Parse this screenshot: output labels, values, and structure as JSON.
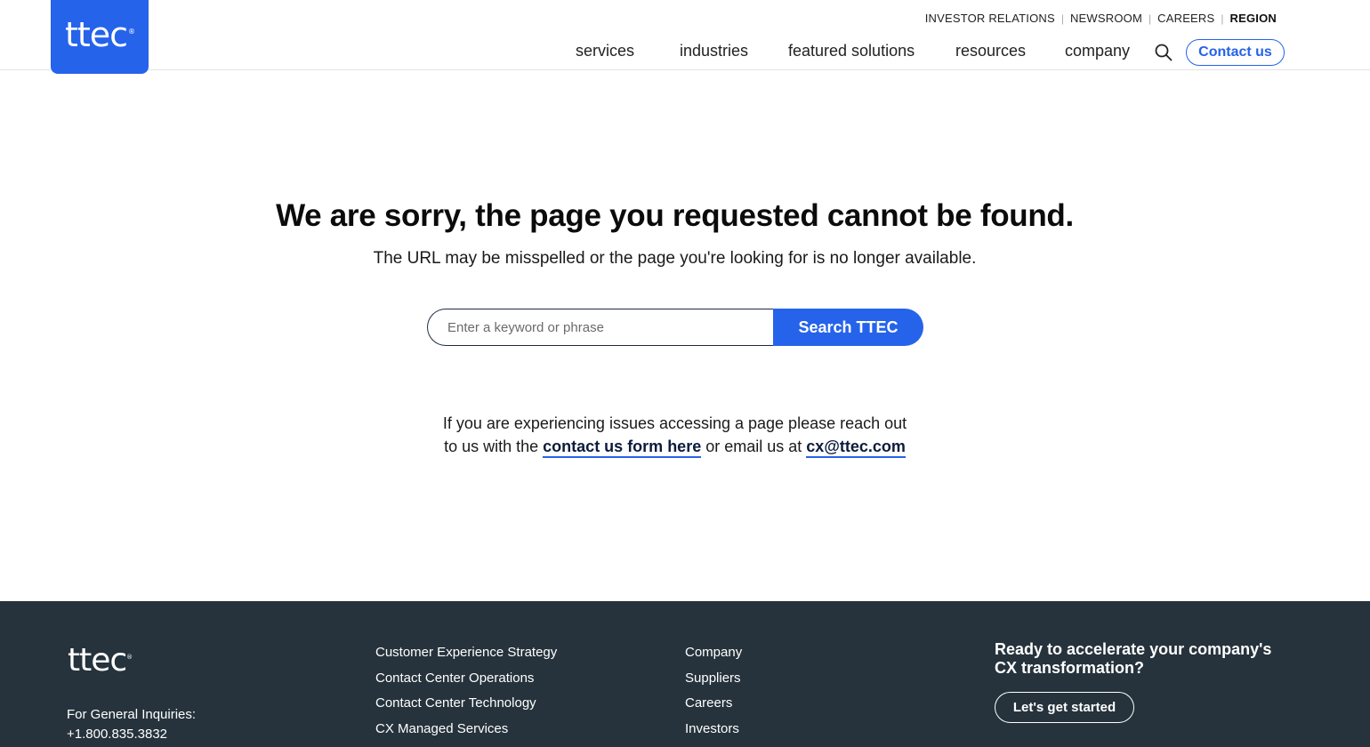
{
  "header": {
    "logo_text": "ttec",
    "util_nav": [
      "INVESTOR RELATIONS",
      "NEWSROOM",
      "CAREERS",
      "REGION"
    ],
    "main_nav": [
      "services",
      "industries",
      "featured solutions",
      "resources",
      "company"
    ],
    "search_icon": "search-icon",
    "contact_label": "Contact us",
    "brand_color": "#2563eb"
  },
  "main": {
    "title": "We are sorry, the page you requested cannot be found.",
    "subtitle": "The URL may be misspelled or the page you're looking for is no longer available.",
    "search": {
      "placeholder": "Enter a keyword or phrase",
      "value": "",
      "button_label": "Search TTEC"
    },
    "help": {
      "line1": "If you are experiencing issues accessing a page please reach out",
      "line2_prefix": "to us with the",
      "contact_link": "contact us form here",
      "line2_middle": "or email us at",
      "email_link": "cx@ttec.com"
    }
  },
  "footer": {
    "logo_text": "ttec",
    "inquiries_label": "For General Inquiries:",
    "inquiries_phone": "+1.800.835.3832",
    "col1": [
      "Customer Experience Strategy",
      "Contact Center Operations",
      "Contact Center Technology",
      "CX Managed Services"
    ],
    "col2": [
      "Company",
      "Suppliers",
      "Careers",
      "Investors"
    ],
    "cta_title": "Ready to accelerate your company's CX transformation?",
    "cta_button": "Let's get started",
    "background_color": "#26333c"
  }
}
